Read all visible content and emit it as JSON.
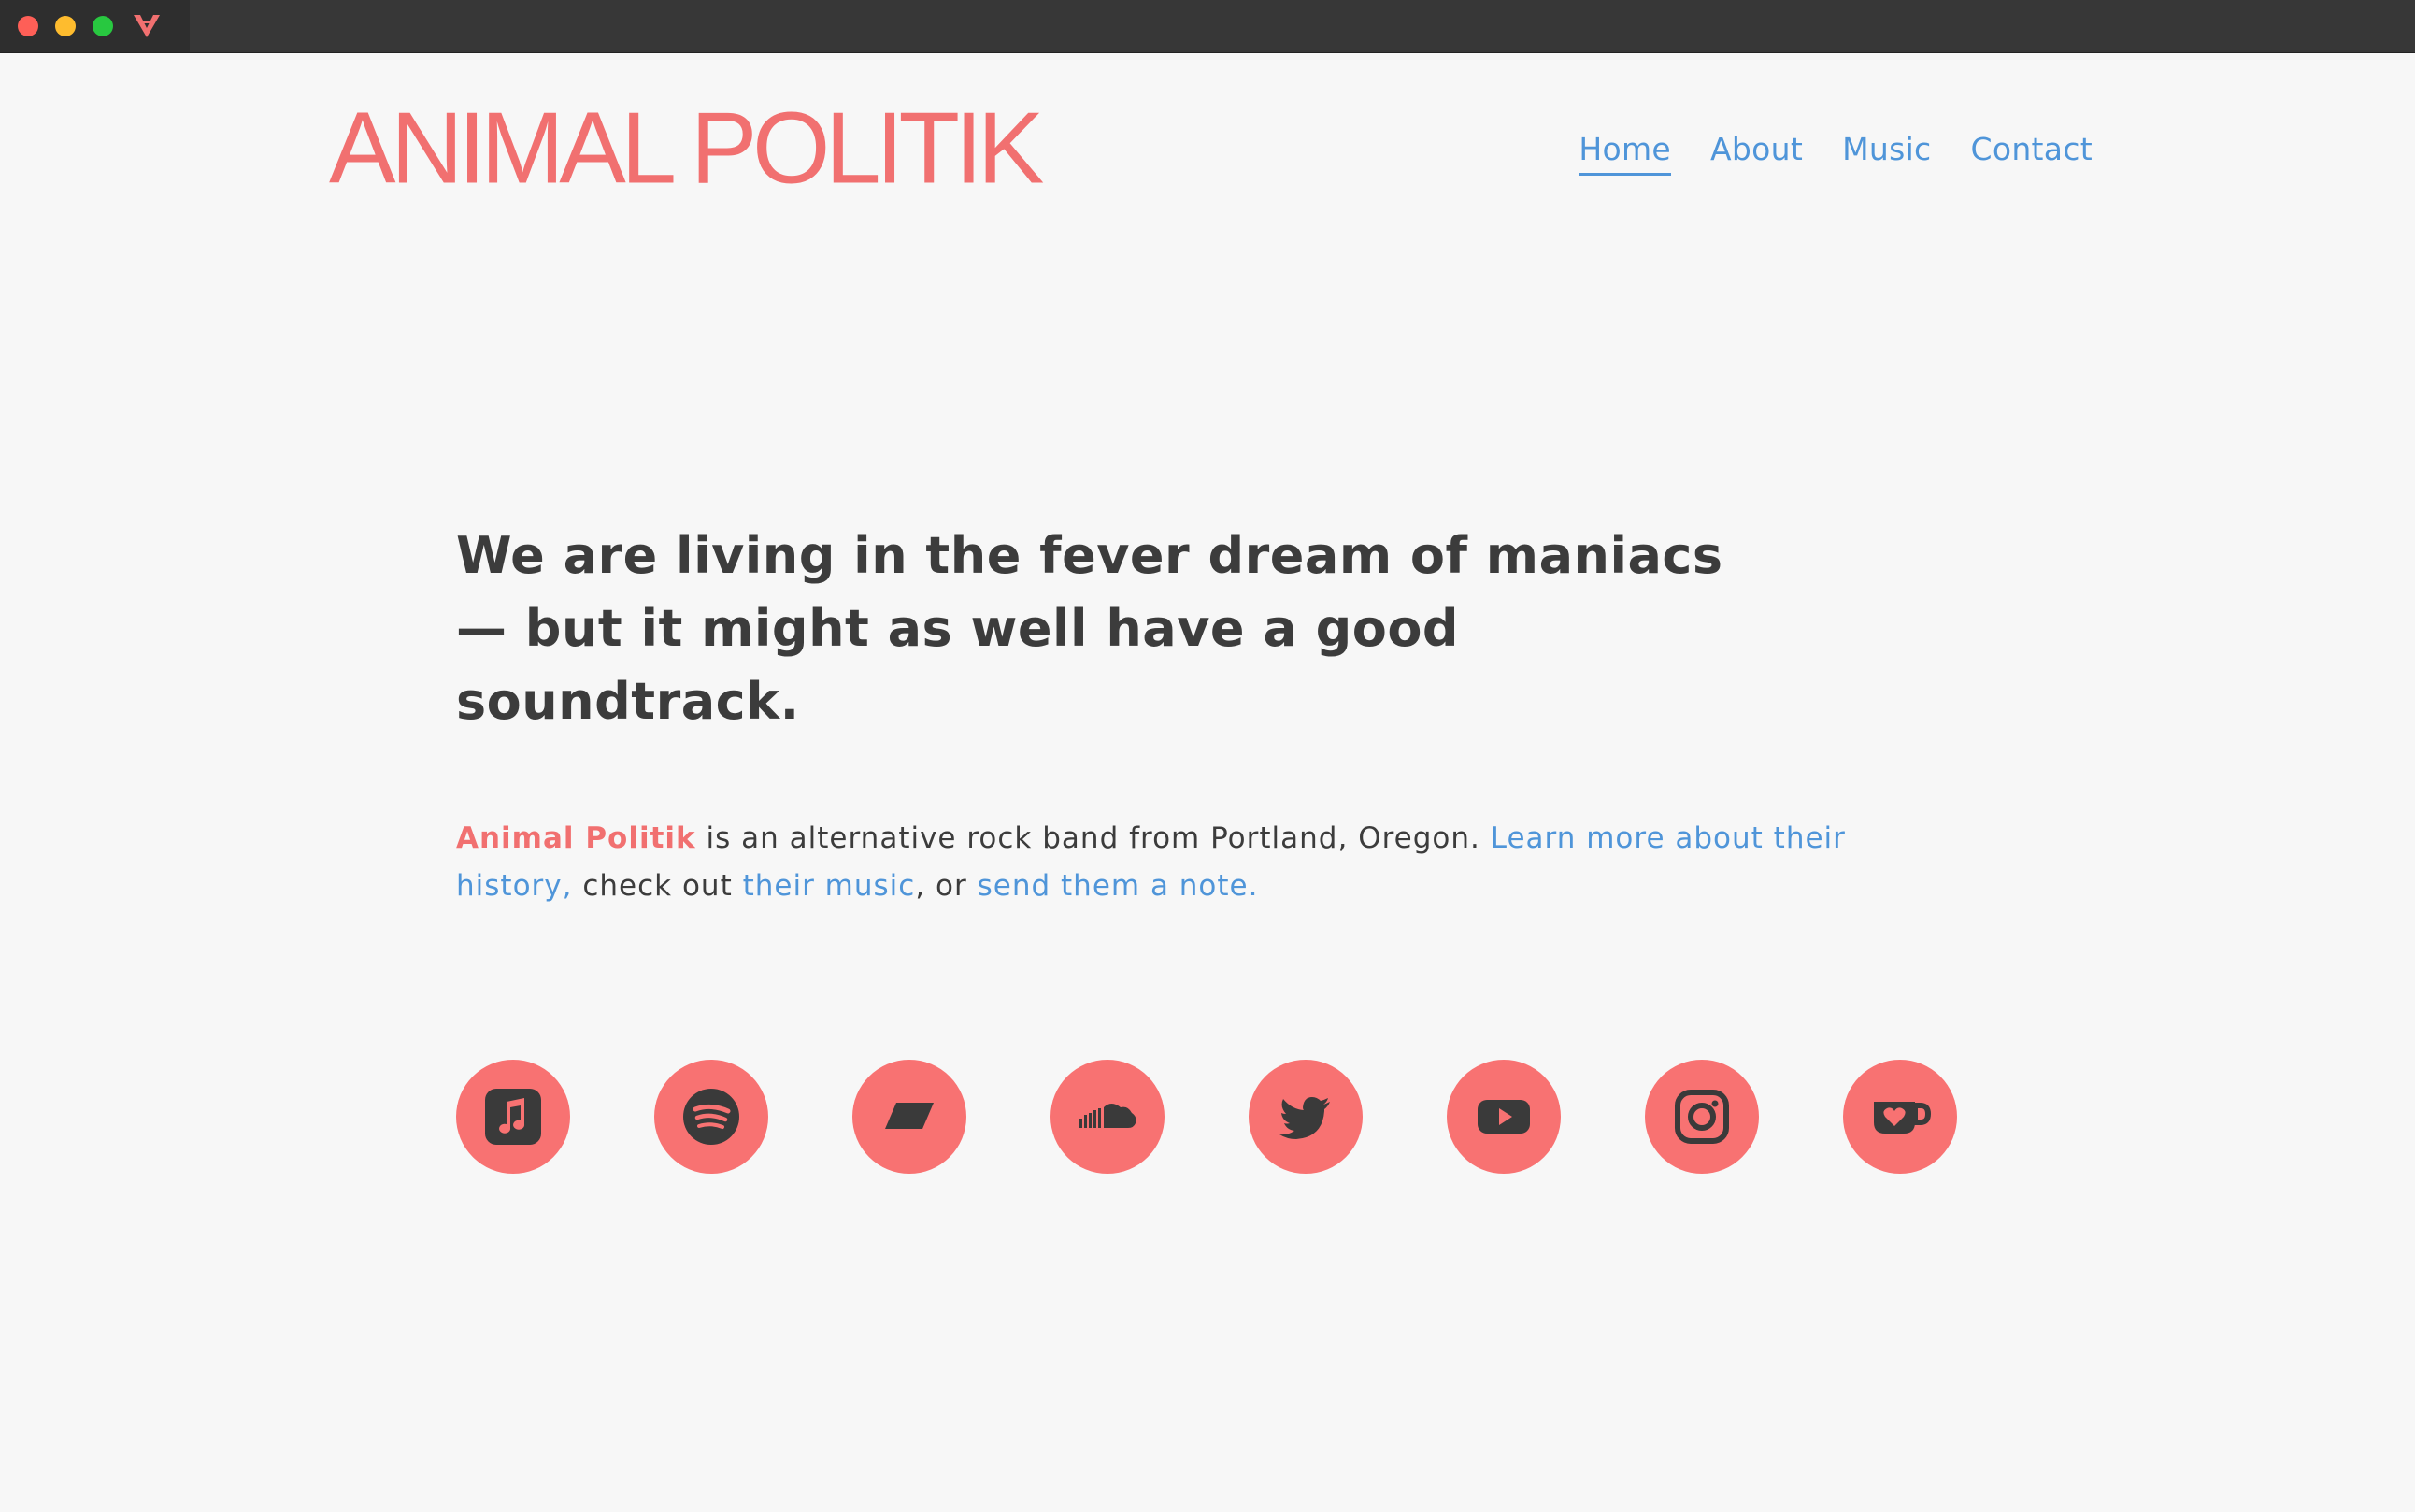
{
  "brand": {
    "logo_text": "ANIMAL POLITIK",
    "accent_color": "#f17070",
    "link_color": "#4f95d9"
  },
  "nav": {
    "items": [
      {
        "label": "Home",
        "active": true
      },
      {
        "label": "About",
        "active": false
      },
      {
        "label": "Music",
        "active": false
      },
      {
        "label": "Contact",
        "active": false
      }
    ]
  },
  "hero": {
    "headline_line1": "We are living in the fever dream of maniacs",
    "headline_line2": "— but it might as well have a good",
    "headline_line3": "soundtrack."
  },
  "intro": {
    "band_name": "Animal Politik",
    "text1": " is an alternative rock band from Portland, Oregon. ",
    "link_history": "Learn more about their history,",
    "text2": " check out ",
    "link_music": "their music",
    "text3": ", or ",
    "link_contact": "send them a note."
  },
  "social": [
    {
      "icon": "apple-music-icon"
    },
    {
      "icon": "spotify-icon"
    },
    {
      "icon": "bandcamp-icon"
    },
    {
      "icon": "soundcloud-icon"
    },
    {
      "icon": "twitter-icon"
    },
    {
      "icon": "youtube-icon"
    },
    {
      "icon": "instagram-icon"
    },
    {
      "icon": "kofi-icon"
    }
  ]
}
